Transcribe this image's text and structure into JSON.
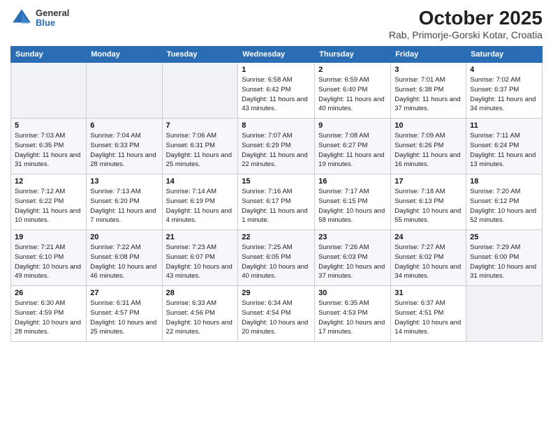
{
  "header": {
    "logo_general": "General",
    "logo_blue": "Blue",
    "title": "October 2025",
    "subtitle": "Rab, Primorje-Gorski Kotar, Croatia"
  },
  "weekdays": [
    "Sunday",
    "Monday",
    "Tuesday",
    "Wednesday",
    "Thursday",
    "Friday",
    "Saturday"
  ],
  "weeks": [
    [
      {
        "day": "",
        "info": ""
      },
      {
        "day": "",
        "info": ""
      },
      {
        "day": "",
        "info": ""
      },
      {
        "day": "1",
        "info": "Sunrise: 6:58 AM\nSunset: 6:42 PM\nDaylight: 11 hours and 43 minutes."
      },
      {
        "day": "2",
        "info": "Sunrise: 6:59 AM\nSunset: 6:40 PM\nDaylight: 11 hours and 40 minutes."
      },
      {
        "day": "3",
        "info": "Sunrise: 7:01 AM\nSunset: 6:38 PM\nDaylight: 11 hours and 37 minutes."
      },
      {
        "day": "4",
        "info": "Sunrise: 7:02 AM\nSunset: 6:37 PM\nDaylight: 11 hours and 34 minutes."
      }
    ],
    [
      {
        "day": "5",
        "info": "Sunrise: 7:03 AM\nSunset: 6:35 PM\nDaylight: 11 hours and 31 minutes."
      },
      {
        "day": "6",
        "info": "Sunrise: 7:04 AM\nSunset: 6:33 PM\nDaylight: 11 hours and 28 minutes."
      },
      {
        "day": "7",
        "info": "Sunrise: 7:06 AM\nSunset: 6:31 PM\nDaylight: 11 hours and 25 minutes."
      },
      {
        "day": "8",
        "info": "Sunrise: 7:07 AM\nSunset: 6:29 PM\nDaylight: 11 hours and 22 minutes."
      },
      {
        "day": "9",
        "info": "Sunrise: 7:08 AM\nSunset: 6:27 PM\nDaylight: 11 hours and 19 minutes."
      },
      {
        "day": "10",
        "info": "Sunrise: 7:09 AM\nSunset: 6:26 PM\nDaylight: 11 hours and 16 minutes."
      },
      {
        "day": "11",
        "info": "Sunrise: 7:11 AM\nSunset: 6:24 PM\nDaylight: 11 hours and 13 minutes."
      }
    ],
    [
      {
        "day": "12",
        "info": "Sunrise: 7:12 AM\nSunset: 6:22 PM\nDaylight: 11 hours and 10 minutes."
      },
      {
        "day": "13",
        "info": "Sunrise: 7:13 AM\nSunset: 6:20 PM\nDaylight: 11 hours and 7 minutes."
      },
      {
        "day": "14",
        "info": "Sunrise: 7:14 AM\nSunset: 6:19 PM\nDaylight: 11 hours and 4 minutes."
      },
      {
        "day": "15",
        "info": "Sunrise: 7:16 AM\nSunset: 6:17 PM\nDaylight: 11 hours and 1 minute."
      },
      {
        "day": "16",
        "info": "Sunrise: 7:17 AM\nSunset: 6:15 PM\nDaylight: 10 hours and 58 minutes."
      },
      {
        "day": "17",
        "info": "Sunrise: 7:18 AM\nSunset: 6:13 PM\nDaylight: 10 hours and 55 minutes."
      },
      {
        "day": "18",
        "info": "Sunrise: 7:20 AM\nSunset: 6:12 PM\nDaylight: 10 hours and 52 minutes."
      }
    ],
    [
      {
        "day": "19",
        "info": "Sunrise: 7:21 AM\nSunset: 6:10 PM\nDaylight: 10 hours and 49 minutes."
      },
      {
        "day": "20",
        "info": "Sunrise: 7:22 AM\nSunset: 6:08 PM\nDaylight: 10 hours and 46 minutes."
      },
      {
        "day": "21",
        "info": "Sunrise: 7:23 AM\nSunset: 6:07 PM\nDaylight: 10 hours and 43 minutes."
      },
      {
        "day": "22",
        "info": "Sunrise: 7:25 AM\nSunset: 6:05 PM\nDaylight: 10 hours and 40 minutes."
      },
      {
        "day": "23",
        "info": "Sunrise: 7:26 AM\nSunset: 6:03 PM\nDaylight: 10 hours and 37 minutes."
      },
      {
        "day": "24",
        "info": "Sunrise: 7:27 AM\nSunset: 6:02 PM\nDaylight: 10 hours and 34 minutes."
      },
      {
        "day": "25",
        "info": "Sunrise: 7:29 AM\nSunset: 6:00 PM\nDaylight: 10 hours and 31 minutes."
      }
    ],
    [
      {
        "day": "26",
        "info": "Sunrise: 6:30 AM\nSunset: 4:59 PM\nDaylight: 10 hours and 28 minutes."
      },
      {
        "day": "27",
        "info": "Sunrise: 6:31 AM\nSunset: 4:57 PM\nDaylight: 10 hours and 25 minutes."
      },
      {
        "day": "28",
        "info": "Sunrise: 6:33 AM\nSunset: 4:56 PM\nDaylight: 10 hours and 22 minutes."
      },
      {
        "day": "29",
        "info": "Sunrise: 6:34 AM\nSunset: 4:54 PM\nDaylight: 10 hours and 20 minutes."
      },
      {
        "day": "30",
        "info": "Sunrise: 6:35 AM\nSunset: 4:53 PM\nDaylight: 10 hours and 17 minutes."
      },
      {
        "day": "31",
        "info": "Sunrise: 6:37 AM\nSunset: 4:51 PM\nDaylight: 10 hours and 14 minutes."
      },
      {
        "day": "",
        "info": ""
      }
    ]
  ]
}
